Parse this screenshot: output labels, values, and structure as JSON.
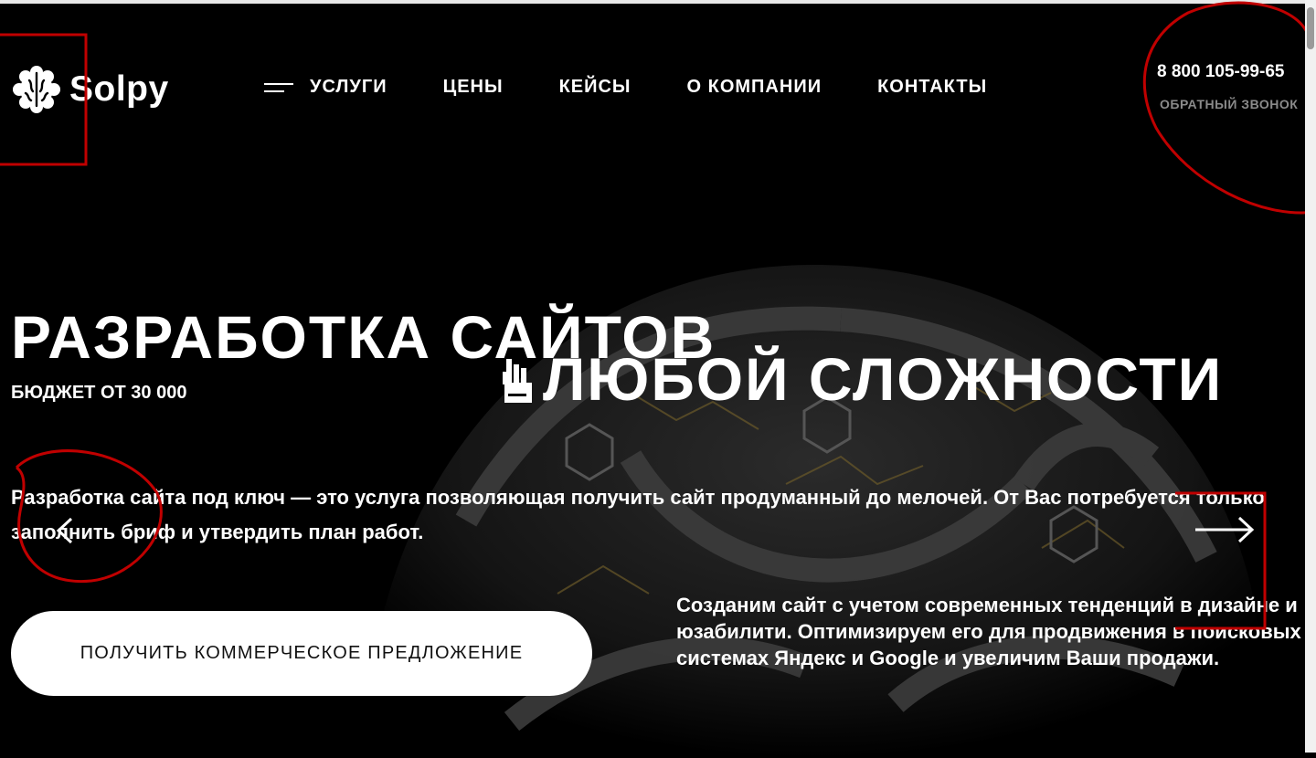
{
  "brand": {
    "name": "Solpy",
    "logo_icon": "brain-icon"
  },
  "nav": {
    "items": [
      {
        "label": "УСЛУГИ",
        "icon": "burger-menu-icon"
      },
      {
        "label": "ЦЕНЫ"
      },
      {
        "label": "КЕЙСЫ"
      },
      {
        "label": "О КОМПАНИИ"
      },
      {
        "label": "КОНТАКТЫ"
      }
    ]
  },
  "contact": {
    "phone": "8 800 105-99-65",
    "callback_label": "ОБРАТНЫЙ ЗВОНОК"
  },
  "hero": {
    "title_line1": "РАЗРАБОТКА САЙТОВ",
    "title_line2": "ЛЮБОЙ СЛОЖНОСТИ",
    "budget": "БЮДЖЕТ ОТ 30 000",
    "description": "Разработка сайта под ключ — это услуга позволяющая получить сайт продуманный до мелочей. От Вас потребуется только заполнить бриф и утвердить план работ.",
    "cta_label": "ПОЛУЧИТЬ КОММЕРЧЕСКОЕ ПРЕДЛОЖЕНИЕ",
    "promo": "Созданим сайт с учетом современных тенденций в дизайне и юзабилити. Оптимизируем его для продвижения в поисковых системах Яндекс и Google и увеличим Ваши продажи.",
    "prev_icon": "arrow-left-icon",
    "next_icon": "arrow-right-icon"
  },
  "colors": {
    "background": "#000000",
    "text": "#ffffff",
    "muted": "#8a8a8a",
    "annotation": "#c00000",
    "button_bg": "#ffffff"
  }
}
